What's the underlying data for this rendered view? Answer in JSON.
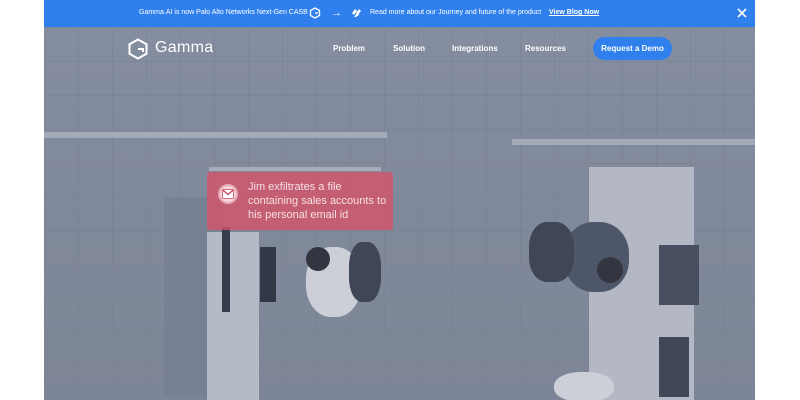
{
  "announcement": {
    "text": "Gamma.AI is now Palo Alto Networks Next-Gen CASB",
    "arrow": "→",
    "text2": "Read more about our Journey and future of the product",
    "link_label": "View Blog Now",
    "icons": [
      "gamma-logo-icon",
      "arrow-right-icon",
      "palo-alto-logo-icon",
      "close-icon"
    ]
  },
  "nav": {
    "brand": "Gamma",
    "links": [
      "Problem",
      "Solution",
      "Integrations",
      "Resources"
    ],
    "cta_label": "Request a Demo"
  },
  "hero": {
    "alert_text": "Jim exfiltrates a file containing sales accounts to his personal email id",
    "alert_icon": "gmail-icon"
  },
  "colors": {
    "accent": "#2f80ed",
    "alert": "#d65268"
  }
}
